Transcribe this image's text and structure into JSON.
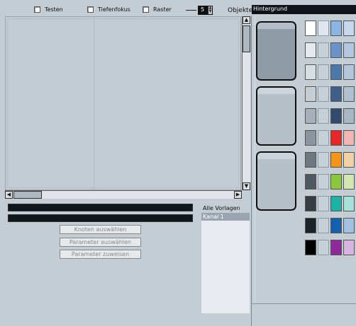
{
  "toolbar": {
    "testen": "Testen",
    "tiefenfokus": "Tiefenfokus",
    "raster": "Raster",
    "spin_value": "5",
    "objekte_label": "Objekte",
    "objekte_value": "Hintergrund"
  },
  "buttons": {
    "knoten": "Knoten auswählen",
    "parameter_auswaehlen": "Parameter auswählen",
    "parameter_zuweisen": "Parameter zuweisen"
  },
  "templates": {
    "header": "Alle Vorlagen",
    "items": [
      "Kanal 1"
    ]
  },
  "palette": {
    "rows": [
      [
        "#ffffff",
        "#dfe6ee",
        "#8ab4e2",
        "#c6d8ee"
      ],
      [
        "#e6eaee",
        "#c7d0d8",
        "#6a94c8",
        "#b3c8e0"
      ],
      [
        "#d7dde3",
        "#c7d0d8",
        "#4d78aa",
        "#b3c5d8"
      ],
      [
        "#c6ced5",
        "#c7d0d8",
        "#3d5f8a",
        "#b0c0d0"
      ],
      [
        "#a6b0ba",
        "#c7d0d8",
        "#334b6e",
        "#a9b6c6"
      ],
      [
        "#8a95a0",
        "#c7d0d8",
        "#e4282a",
        "#f0b6b6"
      ],
      [
        "#6c7780",
        "#c7d0d8",
        "#f3941c",
        "#f1d2a8"
      ],
      [
        "#4f5860",
        "#c7d0d8",
        "#8cc63f",
        "#d1e6b0"
      ],
      [
        "#353c42",
        "#c7d0d8",
        "#1bb2a4",
        "#a7e0d8"
      ],
      [
        "#1d2226",
        "#c7d0d8",
        "#1460ad",
        "#a4c0e0"
      ],
      [
        "#000000",
        "#c7d0d8",
        "#8e2a9a",
        "#d8b4e0"
      ]
    ]
  }
}
